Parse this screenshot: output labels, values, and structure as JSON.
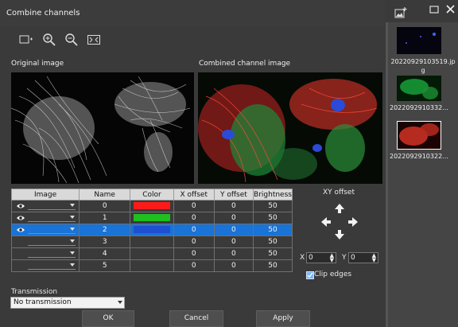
{
  "window": {
    "title": "Combine channels"
  },
  "labels": {
    "original": "Original image",
    "combined": "Combined channel image"
  },
  "table": {
    "headers": [
      "Image",
      "Name",
      "Color",
      "X offset",
      "Y offset",
      "Brightness"
    ],
    "rows": [
      {
        "name": "0",
        "color": "#ff1a1a",
        "x": "0",
        "y": "0",
        "brightness": "50",
        "has_image": true,
        "selected": false
      },
      {
        "name": "1",
        "color": "#1fbf1f",
        "x": "0",
        "y": "0",
        "brightness": "50",
        "has_image": true,
        "selected": false
      },
      {
        "name": "2",
        "color": "#1e4fd0",
        "x": "0",
        "y": "0",
        "brightness": "50",
        "has_image": true,
        "selected": true
      },
      {
        "name": "3",
        "color": "",
        "x": "0",
        "y": "0",
        "brightness": "50",
        "has_image": false,
        "selected": false
      },
      {
        "name": "4",
        "color": "",
        "x": "0",
        "y": "0",
        "brightness": "50",
        "has_image": false,
        "selected": false
      },
      {
        "name": "5",
        "color": "",
        "x": "0",
        "y": "0",
        "brightness": "50",
        "has_image": false,
        "selected": false
      }
    ]
  },
  "xy": {
    "title": "XY offset",
    "x_label": "X",
    "x_value": "0",
    "y_label": "Y",
    "y_value": "0",
    "clip_label": "Clip edges",
    "clip_checked": true
  },
  "transmission": {
    "label": "Transmission",
    "value": "No transmission"
  },
  "buttons": {
    "ok": "OK",
    "cancel": "Cancel",
    "apply": "Apply"
  },
  "thumbnails": [
    {
      "caption": "20220929103519.jpg",
      "color": "#2a4cff"
    },
    {
      "caption": "2022092910332...",
      "color": "#22c04a"
    },
    {
      "caption": "2022092910322...",
      "color": "#e03a2a"
    }
  ]
}
